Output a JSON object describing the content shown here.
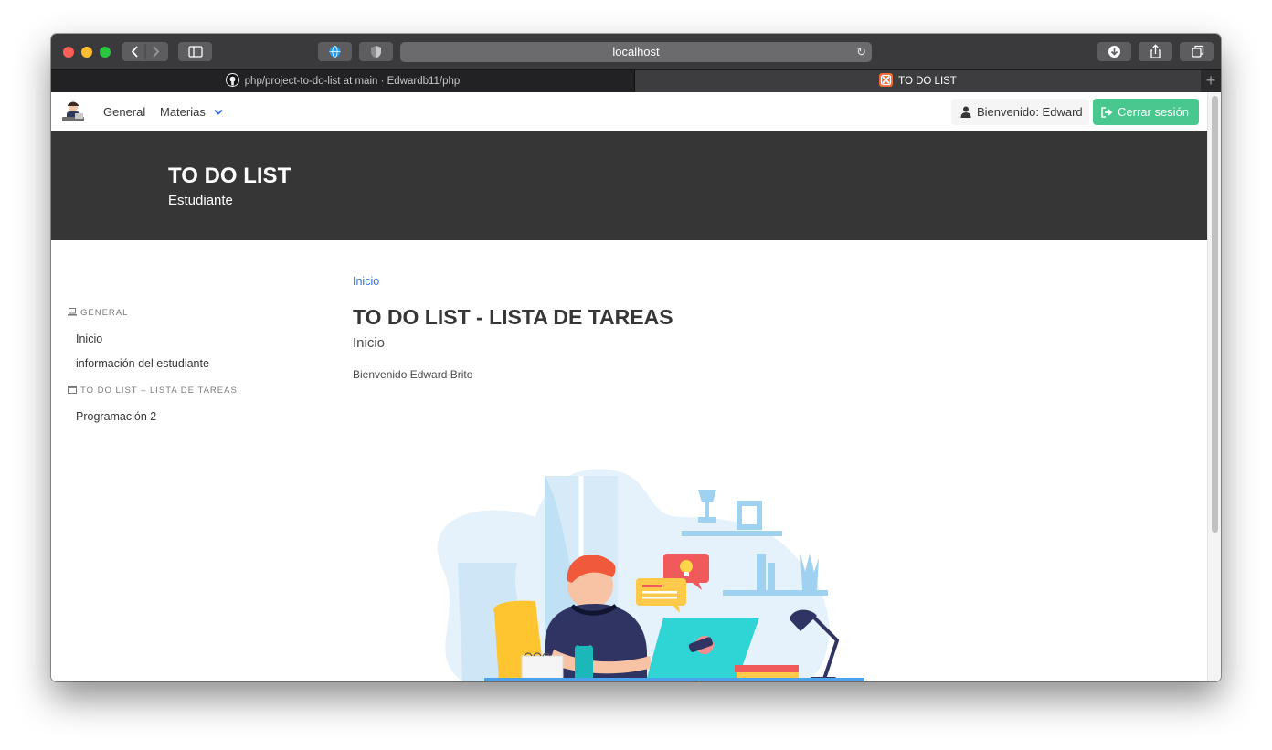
{
  "browser": {
    "url": "localhost",
    "tabs": [
      {
        "label": "php/project-to-do-list at main · Edwardb11/php"
      },
      {
        "label": "TO DO LIST"
      }
    ]
  },
  "navbar": {
    "items": [
      "General",
      "Materias"
    ],
    "user_button": "Bienvenido: Edward",
    "logout_button": "Cerrar sesión"
  },
  "hero": {
    "title": "TO DO LIST",
    "subtitle": "Estudiante"
  },
  "sidebar": {
    "sections": [
      {
        "label": "GENERAL",
        "items": [
          "Inicio",
          "información del estudiante"
        ]
      },
      {
        "label": "TO DO LIST – LISTA DE TAREAS",
        "items": [
          "Programación 2"
        ]
      }
    ]
  },
  "main": {
    "breadcrumb": "Inicio",
    "title": "TO DO LIST - LISTA DE TAREAS",
    "subtitle": "Inicio",
    "welcome": "Bienvenido Edward Brito"
  },
  "colors": {
    "hero_bg": "#363636",
    "logout_bg": "#48c78e",
    "link": "#3273dc"
  }
}
